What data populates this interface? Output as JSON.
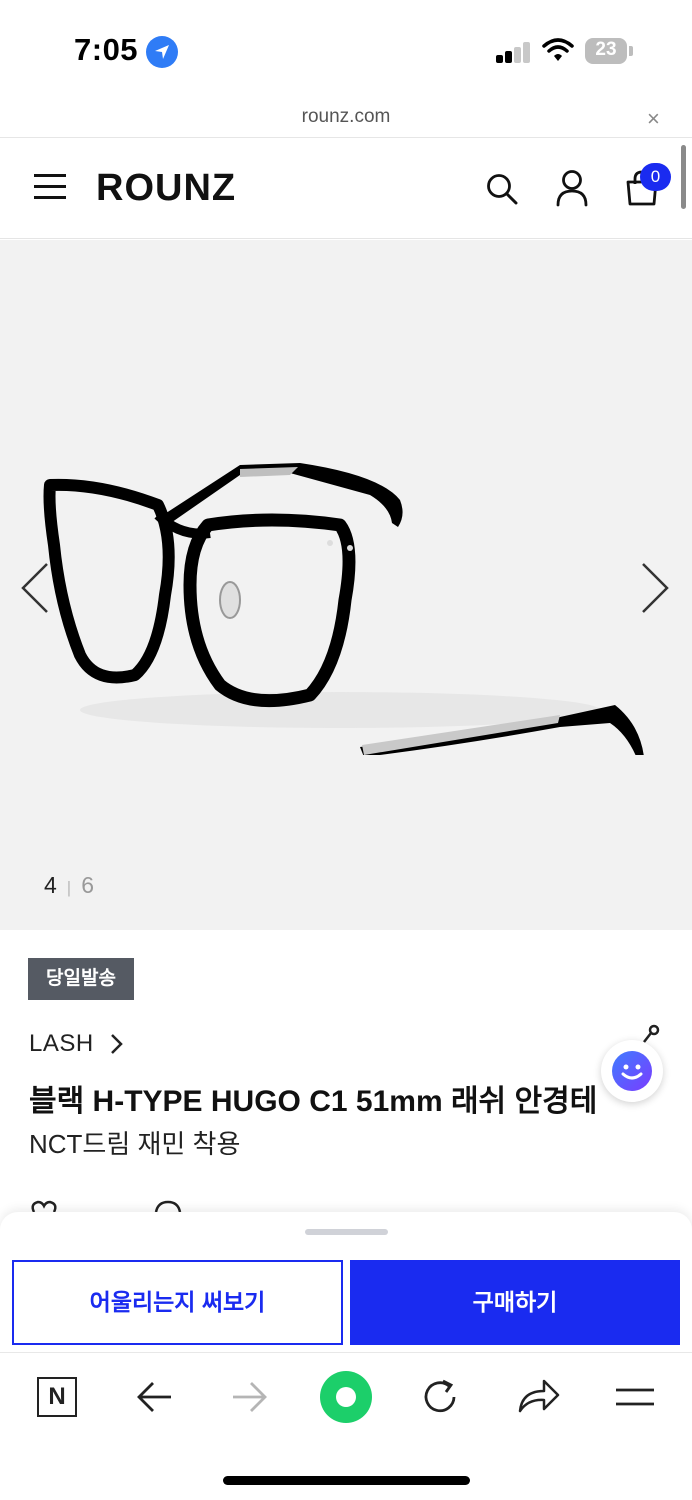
{
  "status_bar": {
    "time": "7:05",
    "battery": "23"
  },
  "browser": {
    "url": "rounz.com",
    "close": "×"
  },
  "header": {
    "logo": "ROUNZ",
    "cart_count": "0"
  },
  "gallery": {
    "current": "4",
    "separator": "|",
    "total": "6"
  },
  "product": {
    "badge": "당일발송",
    "brand": "LASH",
    "title": "블랙 H-TYPE HUGO C1 51mm 래쉬 안경테",
    "subtitle": "NCT드림 재민 착용"
  },
  "actions": {
    "try_on": "어울리는지 써보기",
    "buy": "구매하기"
  },
  "toolbar": {
    "naver_label": "N"
  },
  "colors": {
    "accent": "#1a2bf0",
    "badge_bg": "#555a63",
    "green": "#1ccf6a"
  },
  "icons": [
    "location-arrow-icon",
    "signal-icon",
    "wifi-icon",
    "battery-icon",
    "menu-icon",
    "search-icon",
    "user-icon",
    "cart-icon",
    "chevron-left-icon",
    "chevron-right-icon",
    "share-icon",
    "chat-icon",
    "back-arrow-icon",
    "forward-arrow-icon",
    "refresh-icon",
    "share-arrow-icon",
    "hamburger-icon"
  ]
}
